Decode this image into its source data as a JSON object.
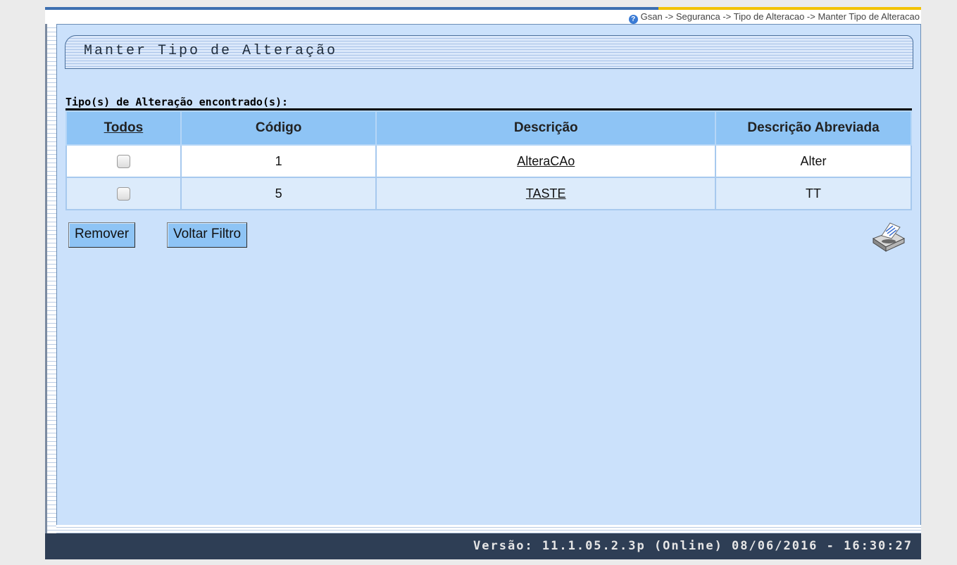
{
  "breadcrumb": "Gsan -> Seguranca -> Tipo de Alteracao -> Manter Tipo de Alteracao",
  "page_title": "Manter Tipo de Alteração",
  "section_label": "Tipo(s) de Alteração encontrado(s):",
  "table": {
    "headers": {
      "todos": "Todos",
      "codigo": "Código",
      "descricao": "Descrição",
      "descricao_abreviada": "Descrição Abreviada"
    },
    "rows": [
      {
        "codigo": "1",
        "descricao": "AlteraCAo",
        "abreviada": "Alter",
        "checked": false
      },
      {
        "codigo": "5",
        "descricao": "TASTE",
        "abreviada": "TT",
        "checked": false
      }
    ]
  },
  "buttons": {
    "remover": "Remover",
    "voltar_filtro": "Voltar Filtro"
  },
  "icons": {
    "help": "help-circle-icon",
    "print": "printer-icon"
  },
  "footer": {
    "version": "Versão: 11.1.05.2.3p (Online) 08/06/2016 - 16:30:27"
  },
  "colors": {
    "panel_bg": "#cbe1fb",
    "header_bg": "#8ec4f5",
    "footer_bg": "#2e3e55"
  }
}
